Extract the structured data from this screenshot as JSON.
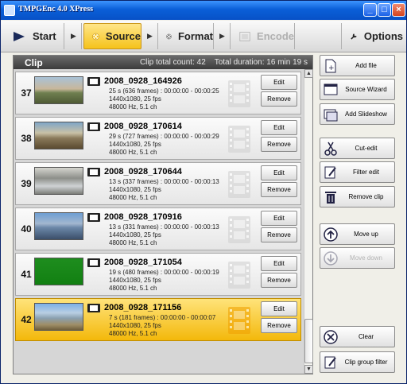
{
  "window": {
    "title": "TMPGEnc 4.0 XPress"
  },
  "toolbar": {
    "start": "Start",
    "source": "Source",
    "format": "Format",
    "encode": "Encode",
    "options": "Options"
  },
  "clip_panel": {
    "label": "Clip",
    "total_count": "Clip total count: 42",
    "total_duration": "Total duration: 16 min 19 s"
  },
  "clips": [
    {
      "num": "37",
      "name": "2008_0928_164926",
      "duration": "25 s (636 frames) : 00:00:00 - 00:00:25",
      "resolution": "1440x1080,  25 fps",
      "audio": "48000  Hz,  5.1 ch",
      "edit": "Edit",
      "remove": "Remove"
    },
    {
      "num": "38",
      "name": "2008_0928_170614",
      "duration": "29 s (727 frames) : 00:00:00 - 00:00:29",
      "resolution": "1440x1080,  25 fps",
      "audio": "48000  Hz,  5.1 ch",
      "edit": "Edit",
      "remove": "Remove"
    },
    {
      "num": "39",
      "name": "2008_0928_170644",
      "duration": "13 s (337 frames) : 00:00:00 - 00:00:13",
      "resolution": "1440x1080,  25 fps",
      "audio": "48000  Hz,  5.1 ch",
      "edit": "Edit",
      "remove": "Remove"
    },
    {
      "num": "40",
      "name": "2008_0928_170916",
      "duration": "13 s (331 frames) : 00:00:00 - 00:00:13",
      "resolution": "1440x1080,  25 fps",
      "audio": "48000  Hz,  5.1 ch",
      "edit": "Edit",
      "remove": "Remove"
    },
    {
      "num": "41",
      "name": "2008_0928_171054",
      "duration": "19 s (480 frames) : 00:00:00 - 00:00:19",
      "resolution": "1440x1080,  25 fps",
      "audio": "48000  Hz,  5.1 ch",
      "edit": "Edit",
      "remove": "Remove"
    },
    {
      "num": "42",
      "name": "2008_0928_171156",
      "duration": "7 s (181 frames) : 00:00:00 - 00:00:07",
      "resolution": "1440x1080,  25 fps",
      "audio": "48000  Hz,  5.1 ch",
      "edit": "Edit",
      "remove": "Remove"
    }
  ],
  "sidebar": {
    "add_file": "Add file",
    "source_wizard": "Source Wizard",
    "add_slideshow": "Add Slideshow",
    "cut_edit": "Cut-edit",
    "filter_edit": "Filter edit",
    "remove_clip": "Remove clip",
    "move_up": "Move up",
    "move_down": "Move down",
    "clear": "Clear",
    "clip_group_filter": "Clip group filter"
  },
  "colors": {
    "selected_accent": "#f5c21a",
    "title_bar": "#0a5fd8"
  }
}
